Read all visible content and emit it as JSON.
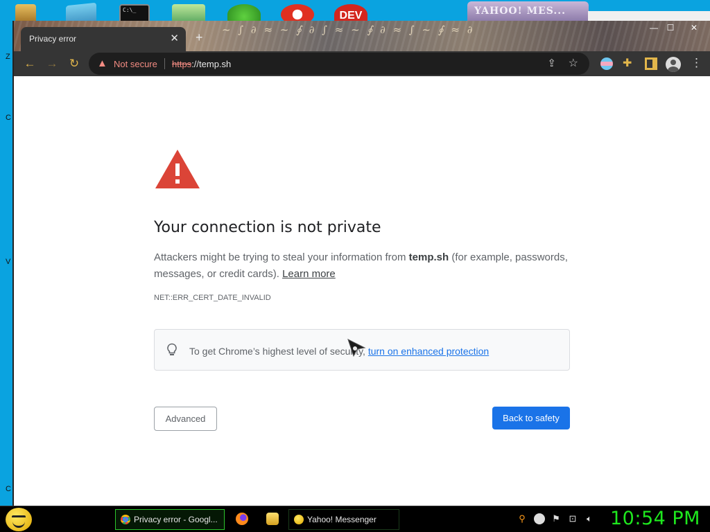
{
  "desktop": {
    "side_letters": [
      "Z",
      "C",
      "V",
      "C"
    ],
    "icons": [
      "folder-icon",
      "network-icon",
      "cmd-icon",
      "image-icon",
      "frog-icon",
      "opera-icon",
      "dev-icon"
    ],
    "cmd_prompt_text": "C:\\_",
    "dev_label": "DEV"
  },
  "yahoo_window": {
    "title": "YAHOO! MES..."
  },
  "browser": {
    "tab": {
      "title": "Privacy error",
      "close_glyph": "✕"
    },
    "new_tab_glyph": "+",
    "window_controls": {
      "minimize": "—",
      "maximize": "☐",
      "close": "✕"
    },
    "toolbar": {
      "back": "←",
      "forward": "→",
      "reload": "↻",
      "security_label": "Not secure",
      "url_scheme": "https",
      "url_rest": "://temp.sh",
      "share": "⇪",
      "star": "☆",
      "puzzle": "✚",
      "menu": "⋮"
    },
    "colors": {
      "accent": "#e2b64b",
      "frame": "#353535",
      "omnibox": "#1e1e1e",
      "warning": "#f28b82"
    }
  },
  "page": {
    "headline": "Your connection is not private",
    "description_part1": "Attackers might be trying to steal your information from ",
    "description_domain": "temp.sh",
    "description_part2": " (for example, passwords, messages, or credit cards). ",
    "learn_more": "Learn more",
    "error_code": "NET::ERR_CERT_DATE_INVALID",
    "enhanced_text": "To get Chrome’s highest level of security, ",
    "enhanced_link": "turn on enhanced protection",
    "advanced_button": "Advanced",
    "back_button": "Back to safety",
    "colors": {
      "triangle": "#db4437",
      "primary_button": "#1a73e8",
      "link": "#1a73e8"
    }
  },
  "taskbar": {
    "items": [
      {
        "label": "Privacy error - Googl...",
        "icon": "chrome-icon"
      },
      {
        "label": "Yahoo! Messenger",
        "icon": "yahoo-messenger-icon"
      }
    ],
    "quick_launch": [
      "firefox-icon",
      "folder-icon"
    ],
    "tray": [
      "search-icon",
      "messenger-status-icon",
      "flag-icon",
      "network-icon",
      "volume-icon"
    ],
    "clock": "10:54 PM",
    "clock_color": "#1ee81e"
  }
}
